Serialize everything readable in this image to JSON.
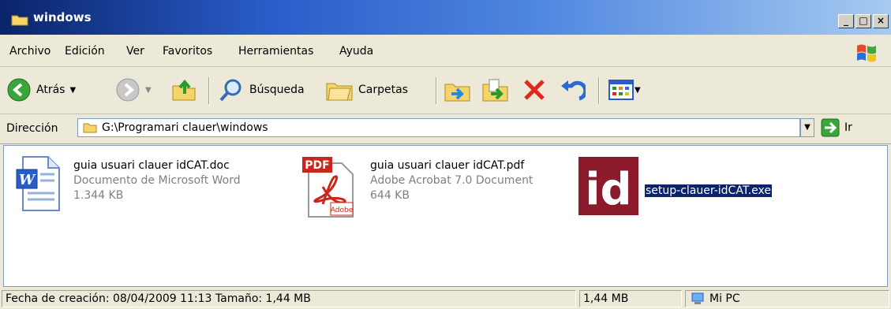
{
  "window": {
    "title": "windows"
  },
  "menu": [
    "Archivo",
    "Edición",
    "Ver",
    "Favoritos",
    "Herramientas",
    "Ayuda"
  ],
  "toolbar": {
    "back_label": "Atrás",
    "search_label": "Búsqueda",
    "folders_label": "Carpetas"
  },
  "address": {
    "label": "Dirección",
    "path": "G:\\Programari clauer\\windows",
    "go_label": "Ir"
  },
  "files": [
    {
      "name": "guia usuari clauer idCAT.doc",
      "type": "Documento de Microsoft Word",
      "size": "1.344 KB",
      "icon": "word-doc-icon"
    },
    {
      "name": "guia usuari clauer idCAT.pdf",
      "type": "Adobe Acrobat 7.0 Document",
      "size": "644 KB",
      "icon": "pdf-icon",
      "icon_text": "PDF",
      "icon_sub": "Adobe"
    },
    {
      "name": "setup-clauer-idCAT.exe",
      "icon": "idcat-exe-icon",
      "icon_text": "id",
      "selected": true
    }
  ],
  "status": {
    "info": "Fecha de creación: 08/04/2009 11:13 Tamaño: 1,44 MB",
    "size": "1,44 MB",
    "location": "Mi PC"
  },
  "colors": {
    "title_bar": "#0a246a",
    "selection": "#0a246a",
    "idcat_red": "#8b1a2b"
  }
}
